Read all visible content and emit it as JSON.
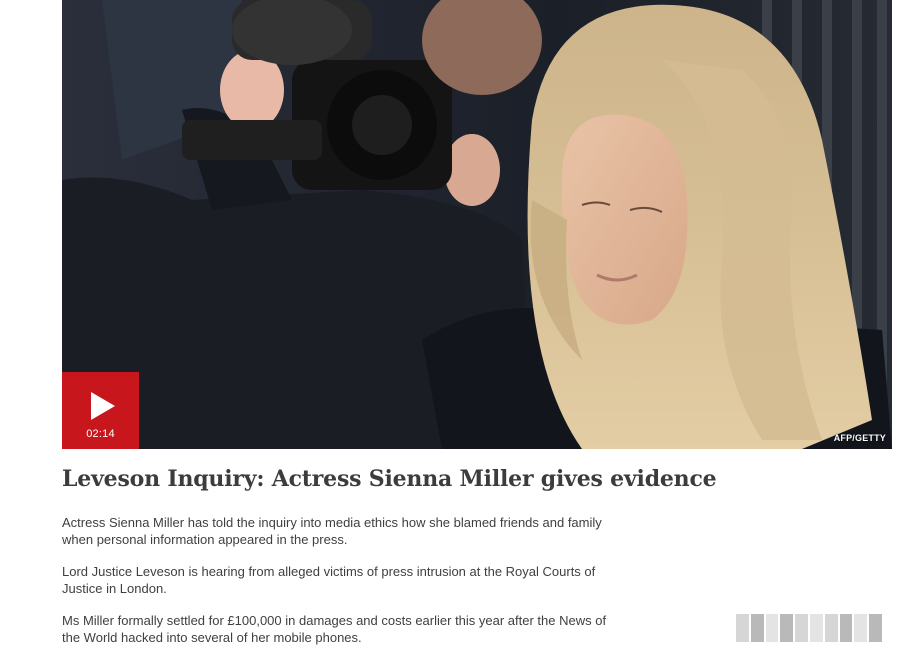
{
  "video": {
    "duration": "02:14",
    "credit": "AFP/GETTY",
    "play_icon": "play-icon"
  },
  "article": {
    "headline": "Leveson Inquiry: Actress Sienna Miller gives evidence",
    "paragraphs": [
      "Actress Sienna Miller has told the inquiry into media ethics how she blamed friends and family when personal information appeared in the press.",
      "Lord Justice Leveson is hearing from alleged victims of press intrusion at the Royal Courts of Justice in London.",
      "Ms Miller formally settled for £100,000 in damages and costs earlier this year after the News of the World hacked into several of her mobile phones."
    ]
  },
  "colors": {
    "accent_red": "#c8161d",
    "text": "#3c3c3c"
  }
}
